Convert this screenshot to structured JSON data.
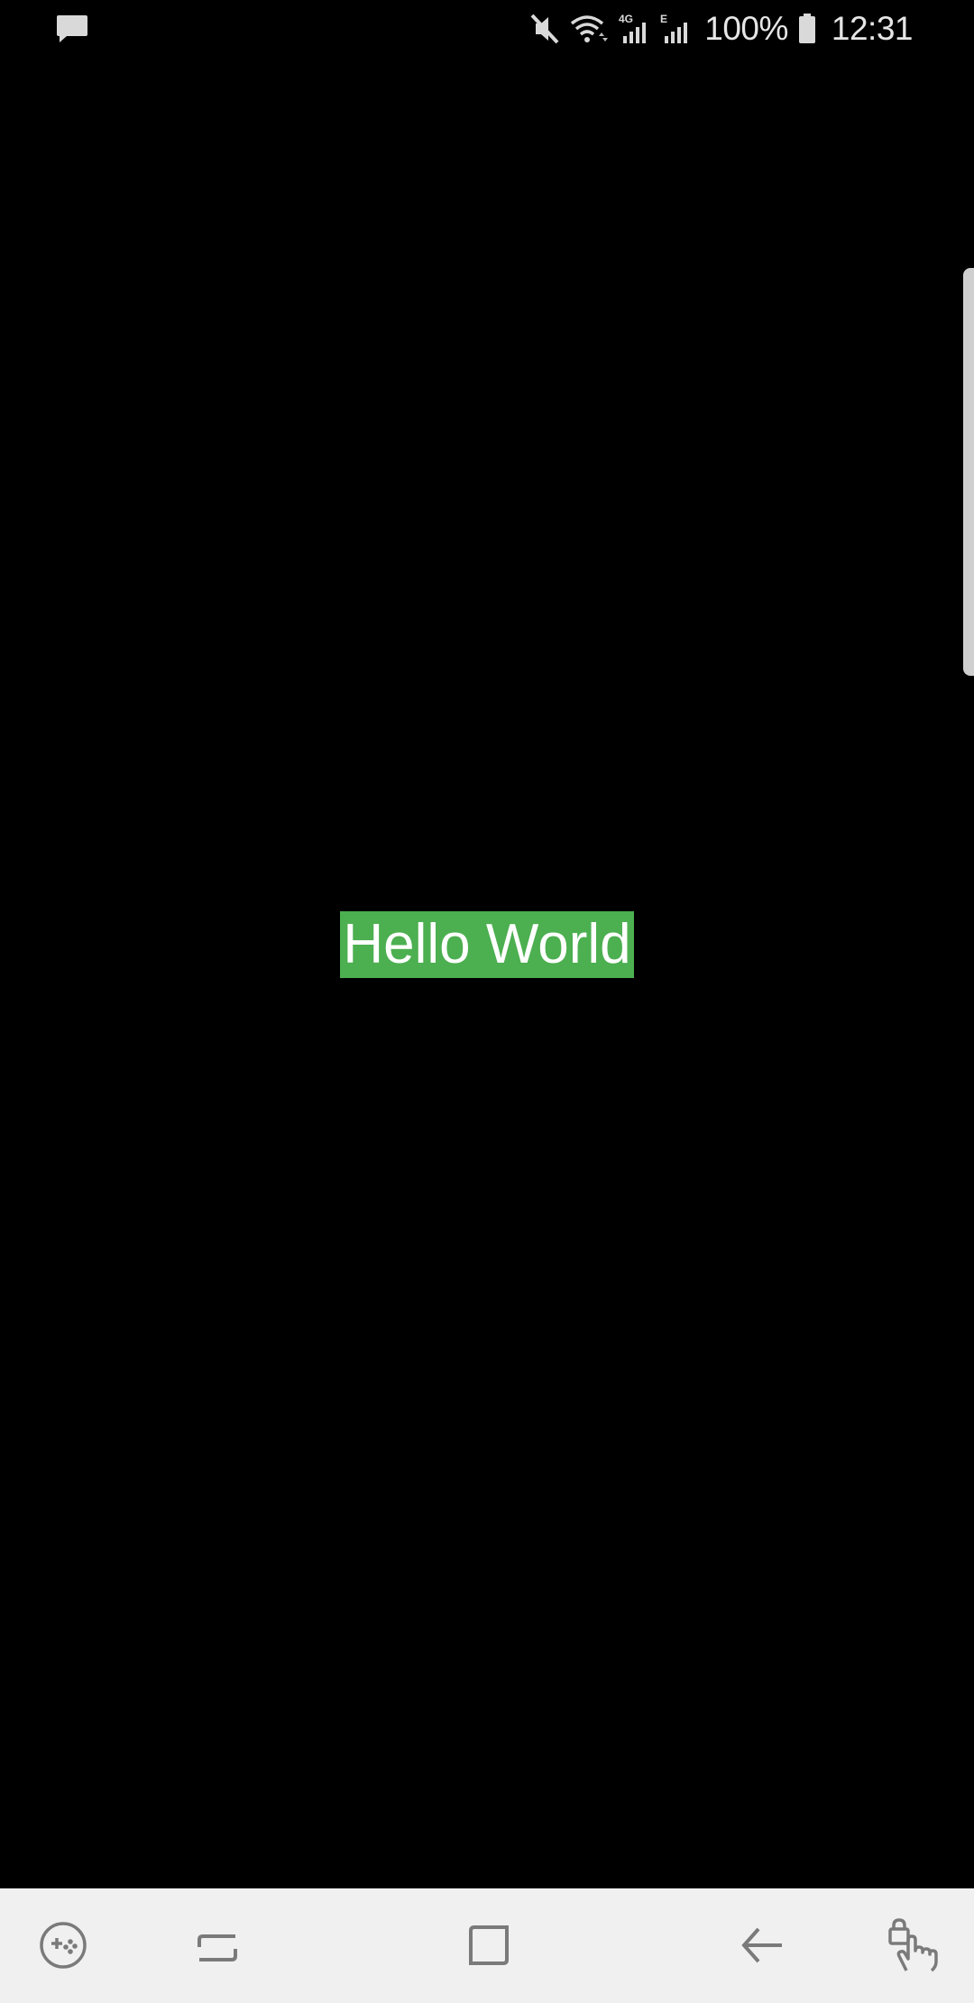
{
  "status_bar": {
    "notification_icon": "message-icon",
    "icons": [
      "mute-icon",
      "wifi-icon",
      "signal-4g-icon",
      "signal-e-icon",
      "battery-icon"
    ],
    "network_label_1": "4G",
    "network_label_2": "E",
    "battery_percent": "100%",
    "time": "12:31"
  },
  "main": {
    "text": "Hello World",
    "highlight_color": "#4caf50",
    "text_color": "#ffffff",
    "background_color": "#000000"
  },
  "nav_bar": {
    "background_color": "#f0f0f0",
    "buttons": [
      "gamepad-icon",
      "recents-icon",
      "home-icon",
      "back-icon",
      "touch-lock-icon"
    ]
  }
}
